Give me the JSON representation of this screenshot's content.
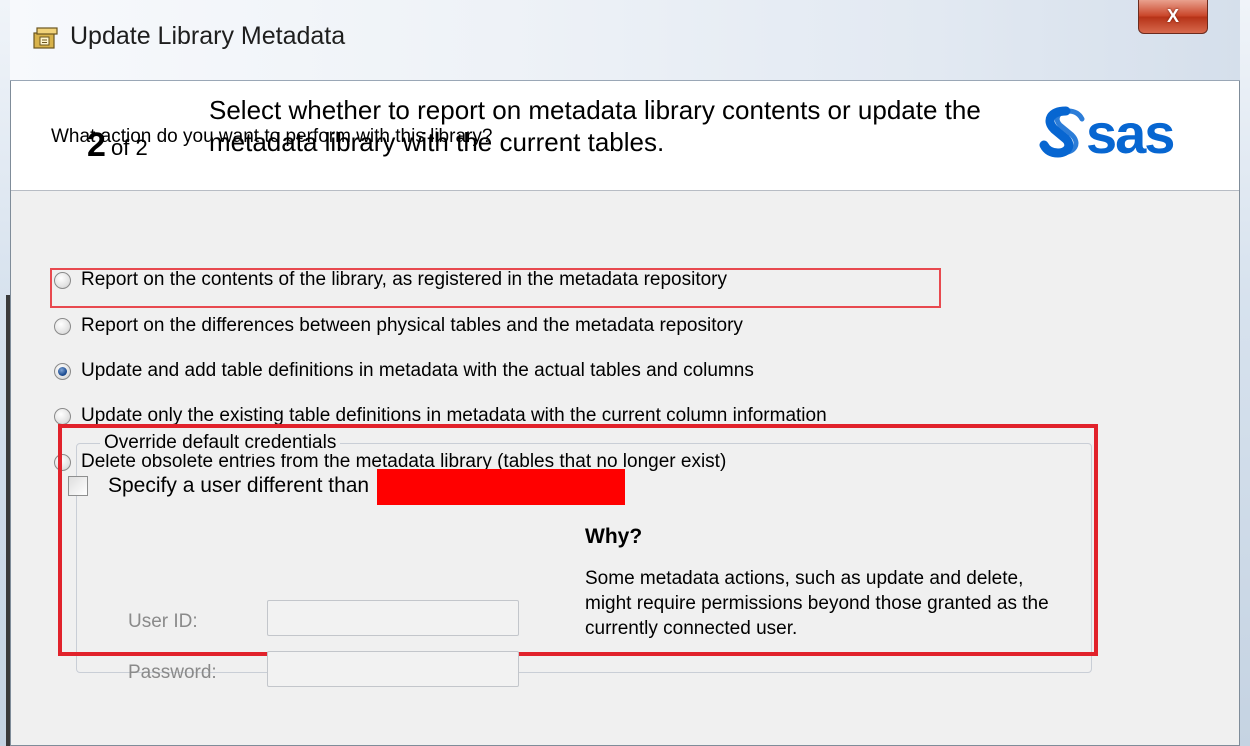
{
  "window": {
    "title": "Update Library Metadata",
    "close_label": "X",
    "accent_close": "#c9462a"
  },
  "header": {
    "step_current": "2",
    "step_total": "of 2",
    "description": "Select whether to report on metadata library contents or update the metadata library with the current tables.",
    "logo_text": "sas",
    "logo_color": "#0766d1"
  },
  "question": "What action do you want to perform with this library?",
  "options": [
    {
      "label": "Report on the contents of the library, as registered in the metadata repository",
      "checked": false
    },
    {
      "label": "Report on the differences between physical tables and the metadata repository",
      "checked": false
    },
    {
      "label": "Update and add table definitions in metadata with the actual tables and columns",
      "checked": true
    },
    {
      "label": "Update only the existing table definitions in metadata with the current column information",
      "checked": false
    },
    {
      "label": "Delete obsolete entries from the metadata library (tables that no longer exist)",
      "checked": false
    }
  ],
  "credentials": {
    "group_title": "Override default credentials",
    "checkbox_label": "Specify a user different than",
    "checkbox_checked": false,
    "user_id_label": "User ID:",
    "user_id_value": "",
    "password_label": "Password:",
    "password_value": "",
    "why_title": "Why?",
    "why_text": "Some metadata actions, such as update and delete, might require permissions beyond those granted as the currently connected user."
  },
  "colors": {
    "highlight_red": "#e1222b",
    "redaction": "#ff0000"
  }
}
